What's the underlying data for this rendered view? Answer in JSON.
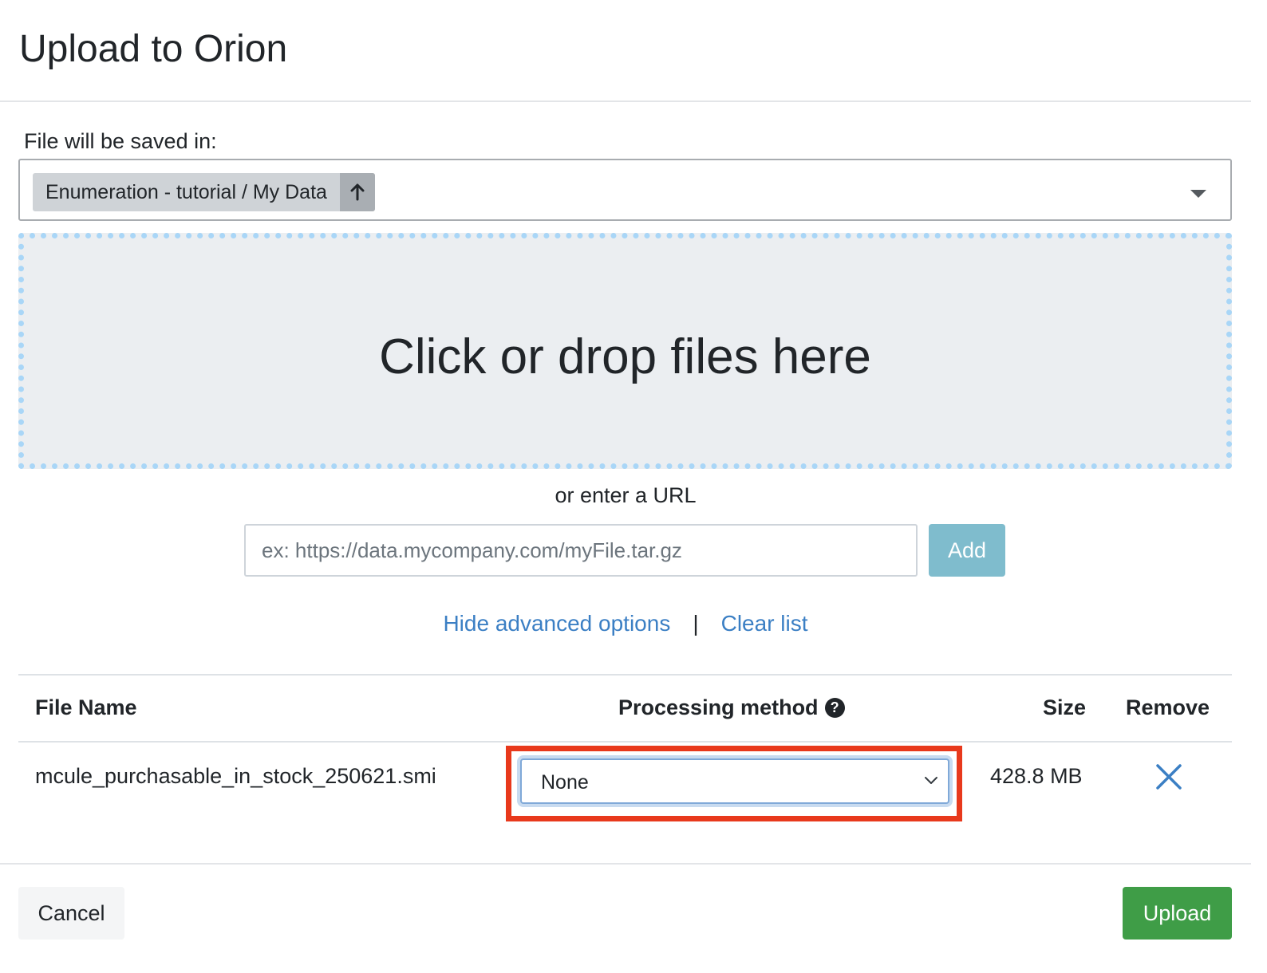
{
  "dialog": {
    "title": "Upload to Orion"
  },
  "destination": {
    "label": "File will be saved in:",
    "folder": "Enumeration - tutorial / My Data",
    "up_icon": "arrow-up-icon",
    "caret_icon": "caret-down-icon"
  },
  "dropzone": {
    "text": "Click or drop files here",
    "border_color": "#a9d6f7"
  },
  "url": {
    "label": "or enter a URL",
    "placeholder": "ex: https://data.mycompany.com/myFile.tar.gz",
    "value": "",
    "add_label": "Add"
  },
  "links": {
    "hide_advanced": "Hide advanced options",
    "separator": "|",
    "clear_list": "Clear list"
  },
  "table": {
    "headers": {
      "file_name": "File Name",
      "processing_method": "Processing method",
      "size": "Size",
      "remove": "Remove"
    },
    "help_icon": "question-circle-icon",
    "rows": [
      {
        "file_name": "mcule_purchasable_in_stock_250621.smi",
        "processing_method": "None",
        "size": "428.8 MB",
        "remove_icon": "close-icon"
      }
    ]
  },
  "footer": {
    "cancel_label": "Cancel",
    "upload_label": "Upload"
  },
  "colors": {
    "link": "#3b7fc4",
    "add_button": "#7fbccd",
    "upload_button": "#3f9d47",
    "highlight": "#e8391c",
    "remove_icon": "#3b7fc4"
  }
}
